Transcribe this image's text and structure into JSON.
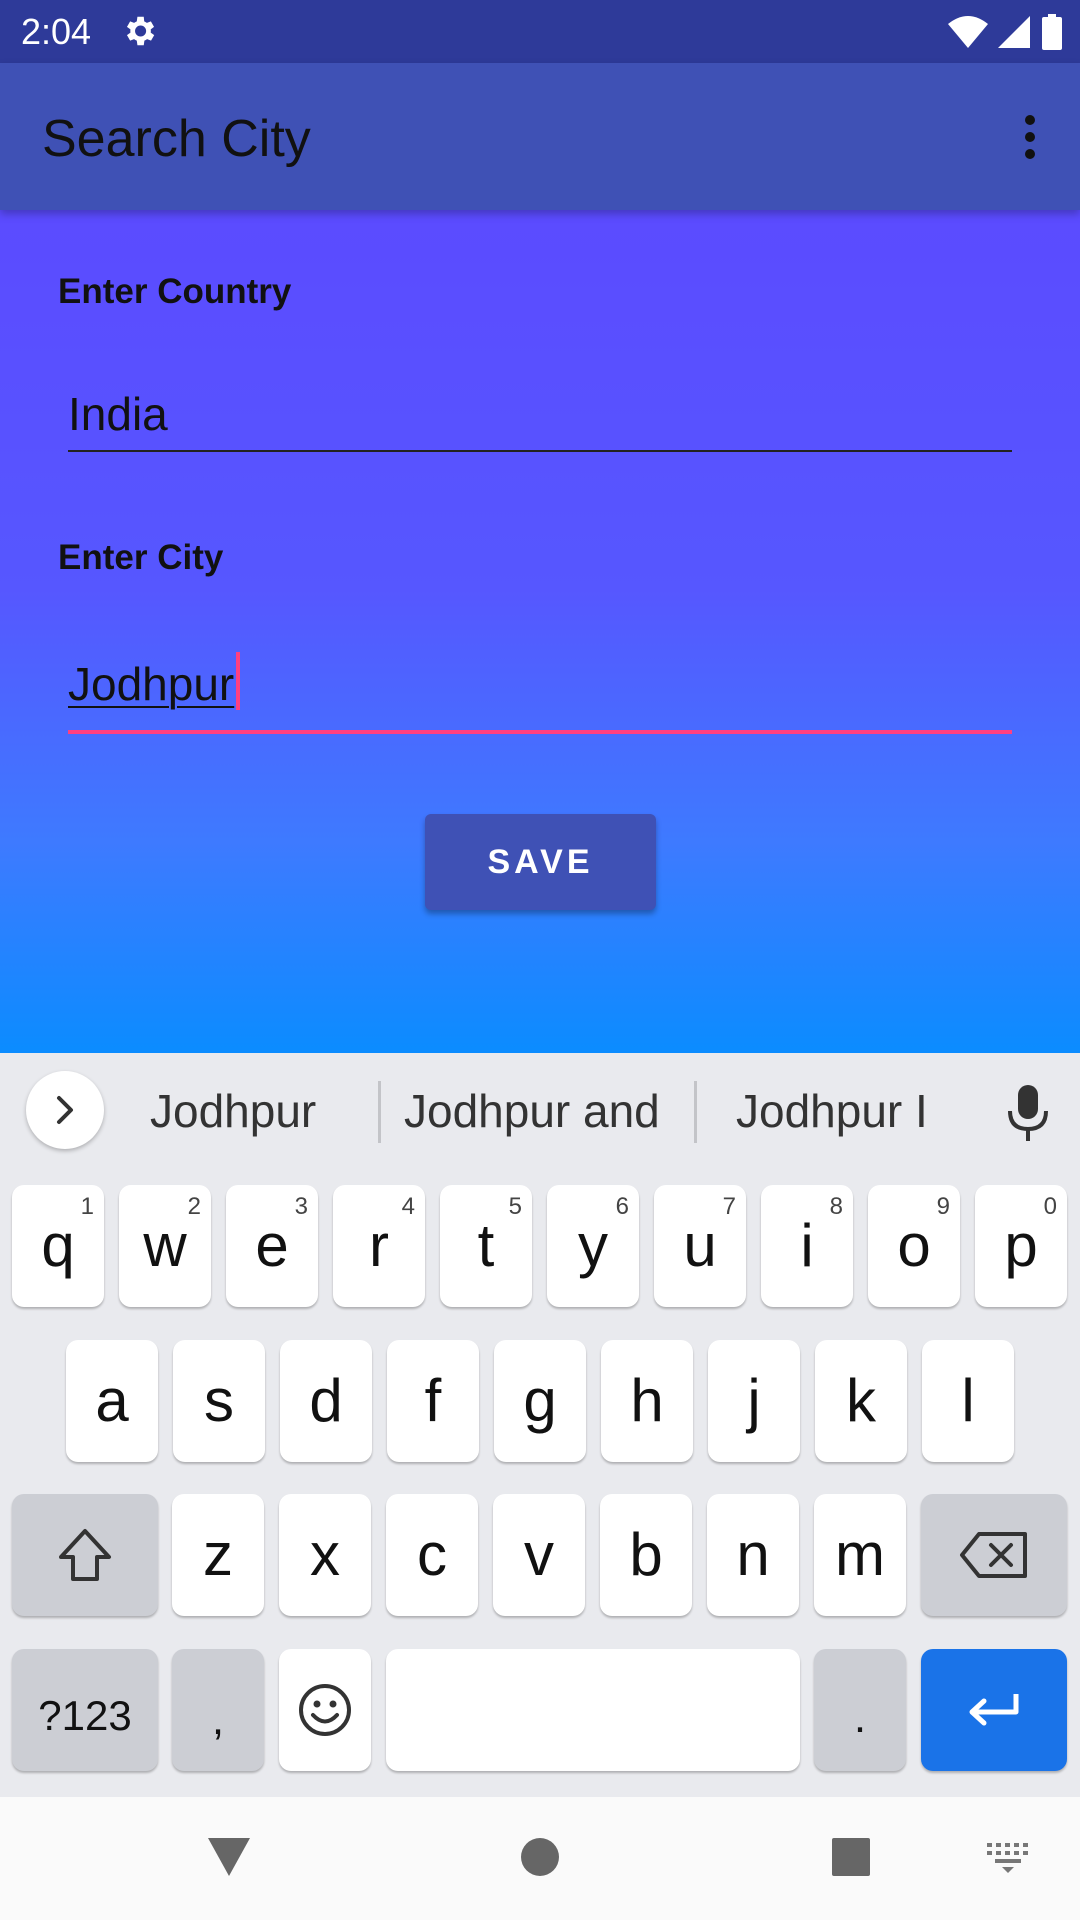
{
  "status_bar": {
    "time": "2:04"
  },
  "app_bar": {
    "title": "Search City"
  },
  "form": {
    "country_label": "Enter Country",
    "country_value": "India",
    "city_label": "Enter City",
    "city_value": "Jodhpur",
    "save_label": "SAVE"
  },
  "keyboard": {
    "suggestions": [
      "Jodhpur",
      "Jodhpur and",
      "Jodhpur I"
    ],
    "row1": [
      {
        "ch": "q",
        "num": "1"
      },
      {
        "ch": "w",
        "num": "2"
      },
      {
        "ch": "e",
        "num": "3"
      },
      {
        "ch": "r",
        "num": "4"
      },
      {
        "ch": "t",
        "num": "5"
      },
      {
        "ch": "y",
        "num": "6"
      },
      {
        "ch": "u",
        "num": "7"
      },
      {
        "ch": "i",
        "num": "8"
      },
      {
        "ch": "o",
        "num": "9"
      },
      {
        "ch": "p",
        "num": "0"
      }
    ],
    "row2": [
      "a",
      "s",
      "d",
      "f",
      "g",
      "h",
      "j",
      "k",
      "l"
    ],
    "row3": [
      "z",
      "x",
      "c",
      "v",
      "b",
      "n",
      "m"
    ],
    "symbols_label": "?123",
    "comma": ",",
    "period": "."
  },
  "colors": {
    "status_bar": "#2e3a99",
    "app_bar": "#3f51b5",
    "accent": "#ff4081",
    "enter_key": "#1a73e8"
  },
  "icons": {
    "status": [
      "gear-icon",
      "wifi-icon",
      "signal-icon",
      "battery-icon"
    ],
    "app_bar": [
      "more-vert-icon"
    ],
    "keyboard": [
      "chevron-right-icon",
      "mic-icon",
      "shift-icon",
      "backspace-icon",
      "emoji-icon",
      "enter-icon"
    ],
    "nav": [
      "back-icon",
      "home-icon",
      "recents-icon",
      "keyboard-switch-icon"
    ]
  }
}
